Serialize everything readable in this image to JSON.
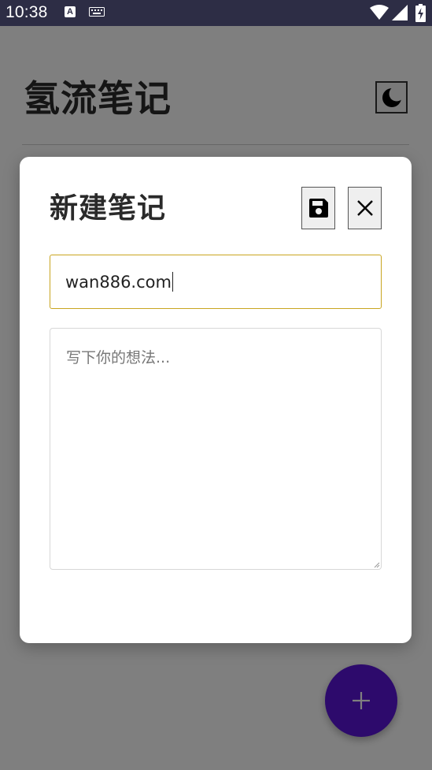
{
  "status_bar": {
    "time": "10:38",
    "a_badge": "A",
    "icons": [
      "keyboard-icon",
      "wifi-icon",
      "signal-icon",
      "battery-charging-icon"
    ]
  },
  "app": {
    "title": "氢流笔记",
    "theme_toggle_icon": "moon-icon",
    "fab_icon": "plus-icon",
    "fab_color": "#5a14d8"
  },
  "modal": {
    "title": "新建笔记",
    "save_icon": "save-icon",
    "close_icon": "close-icon",
    "title_input": {
      "value": "wan886.com"
    },
    "content_textarea": {
      "value": "",
      "placeholder": "写下你的想法..."
    }
  },
  "colors": {
    "status_bar": "#2d2d45",
    "overlay": "rgba(0,0,0,0.5)",
    "input_focus_border": "#c9a520"
  }
}
